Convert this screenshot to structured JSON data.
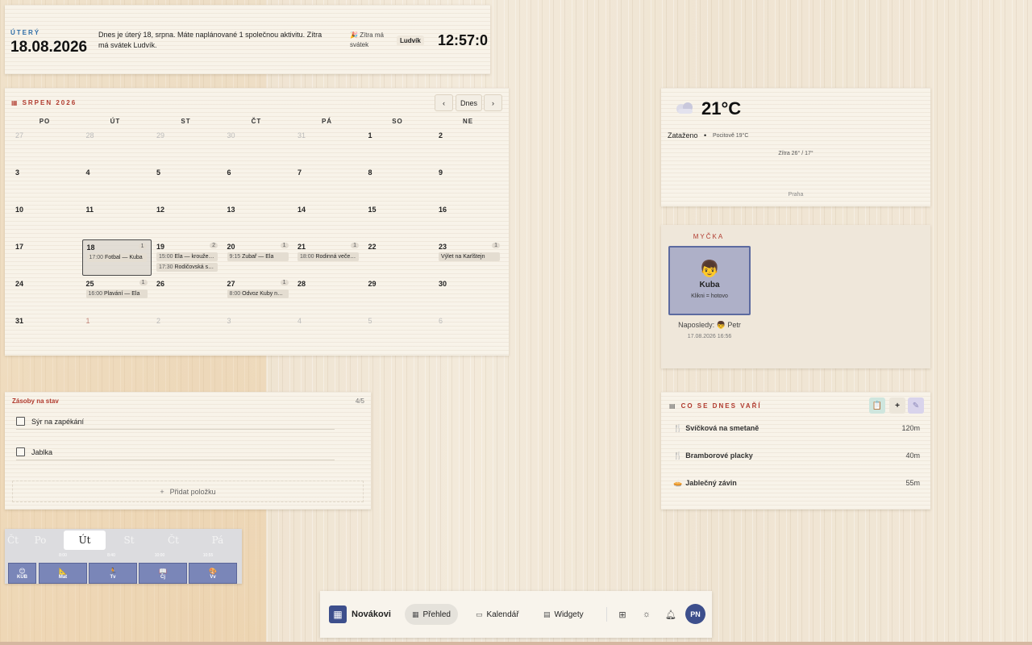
{
  "header": {
    "weekday": "ÚTERÝ",
    "date": "18.08.2026",
    "message": "Dnes je úterý 18, srpna. Máte naplánované 1 společnou aktivitu. Zítra má svátek Ludvík.",
    "tomorrow_label": "Zítra má svátek",
    "tomorrow_name": "Ludvík",
    "clock": "12:57:0"
  },
  "calendar": {
    "title": "SRPEN 2026",
    "prev_label": "‹",
    "today_label": "Dnes",
    "next_label": "›",
    "weekdays": [
      "PO",
      "ÚT",
      "ST",
      "ČT",
      "PÁ",
      "SO",
      "NE"
    ],
    "weeks": [
      [
        {
          "n": "27",
          "s": "out"
        },
        {
          "n": "28",
          "s": "out"
        },
        {
          "n": "29",
          "s": "out"
        },
        {
          "n": "30",
          "s": "out"
        },
        {
          "n": "31",
          "s": "out"
        },
        {
          "n": "1"
        },
        {
          "n": "2"
        }
      ],
      [
        {
          "n": "3"
        },
        {
          "n": "4"
        },
        {
          "n": "5"
        },
        {
          "n": "6"
        },
        {
          "n": "7"
        },
        {
          "n": "8"
        },
        {
          "n": "9"
        }
      ],
      [
        {
          "n": "10"
        },
        {
          "n": "11"
        },
        {
          "n": "12"
        },
        {
          "n": "13"
        },
        {
          "n": "14"
        },
        {
          "n": "15"
        },
        {
          "n": "16"
        }
      ],
      [
        {
          "n": "17"
        },
        {
          "n": "18",
          "s": "today",
          "cnt": "1",
          "ev": [
            {
              "t": "17:00",
              "x": "Fotbal — Kuba"
            }
          ]
        },
        {
          "n": "19",
          "cnt": "2",
          "ev": [
            {
              "t": "15:00",
              "x": "Ela — kroužek..."
            },
            {
              "t": "17:30",
              "x": "Rodičovská sc..."
            }
          ]
        },
        {
          "n": "20",
          "cnt": "1",
          "ev": [
            {
              "t": "9:15",
              "x": "Zubař — Ela"
            }
          ]
        },
        {
          "n": "21",
          "cnt": "1",
          "ev": [
            {
              "t": "18:00",
              "x": "Rodinná večeř..."
            }
          ]
        },
        {
          "n": "22"
        },
        {
          "n": "23",
          "cnt": "1",
          "ev": [
            {
              "t": "",
              "x": "Výlet na Karlštejn"
            }
          ]
        }
      ],
      [
        {
          "n": "24"
        },
        {
          "n": "25",
          "cnt": "1",
          "ev": [
            {
              "t": "16:00",
              "x": "Plavání — Ela"
            }
          ]
        },
        {
          "n": "26"
        },
        {
          "n": "27",
          "cnt": "1",
          "ev": [
            {
              "t": "8:00",
              "x": "Odvoz Kuby na ..."
            }
          ]
        },
        {
          "n": "28"
        },
        {
          "n": "29"
        },
        {
          "n": "30"
        }
      ],
      [
        {
          "n": "31"
        },
        {
          "n": "1",
          "s": "outb"
        },
        {
          "n": "2",
          "s": "out"
        },
        {
          "n": "3",
          "s": "out"
        },
        {
          "n": "4",
          "s": "out"
        },
        {
          "n": "5",
          "s": "out"
        },
        {
          "n": "6",
          "s": "out"
        }
      ]
    ]
  },
  "supplies": {
    "title": "Zásoby na stav",
    "count": "4/5",
    "items": [
      "Sýr na zapékání",
      "Jablka"
    ],
    "add_label": "Přidat položku",
    "add_icon": "plus-icon"
  },
  "schedule": {
    "days": [
      "Čt",
      "Po",
      "Út",
      "St",
      "Čt",
      "Pá"
    ],
    "times": [
      "8:00",
      "8:40",
      "10:00",
      "10:55"
    ],
    "tiles": [
      {
        "icon": "😊",
        "label": "KUB"
      },
      {
        "icon": "📐",
        "label": "Mat"
      },
      {
        "icon": "🏃",
        "label": "Tv"
      },
      {
        "icon": "📖",
        "label": "Čj"
      },
      {
        "icon": "🎨",
        "label": "Vv"
      }
    ]
  },
  "weather": {
    "icon": "cloud-icon",
    "temp": "21°C",
    "condition": "Zataženo",
    "feels": "Pocitově 19°C",
    "tomorrow": "Zítra 26° / 17°",
    "city": "Praha"
  },
  "dishwasher": {
    "title": "MYČKA",
    "person_emoji": "👦",
    "person": "Kuba",
    "hint": "Klikni = hotovo",
    "last_label": "Naposledy:",
    "last_emoji": "👦",
    "last_person": "Petr",
    "last_when": "17.08.2026 16:56"
  },
  "cooking": {
    "title": "CO SE DNES VAŘÍ",
    "add_label": "+",
    "meals": [
      {
        "icon": "🍴",
        "name": "Svíčková na smetaně",
        "time": "120m"
      },
      {
        "icon": "🍴",
        "name": "Bramborové placky",
        "time": "40m"
      },
      {
        "icon": "🥧",
        "name": "Jablečný závin",
        "time": "55m"
      }
    ]
  },
  "nav": {
    "brand": "Novákovi",
    "tabs": [
      "Přehled",
      "Kalendář",
      "Widgety"
    ],
    "avatar": "PN"
  },
  "colors": {
    "accent": "#b03a2e",
    "navy": "#3d4f8c",
    "blue_label": "#2f6ea8"
  }
}
